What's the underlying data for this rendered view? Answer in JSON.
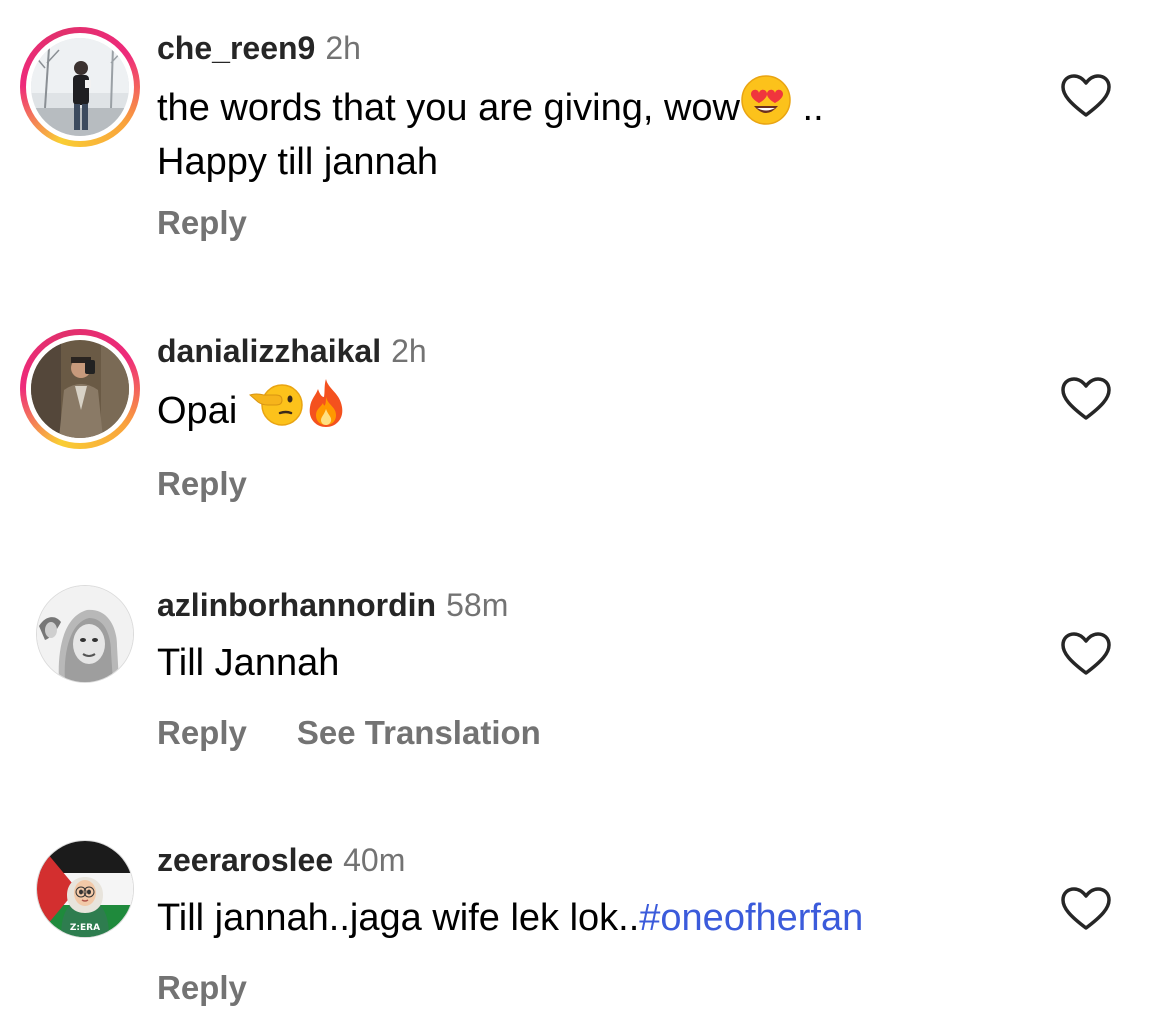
{
  "comments": [
    {
      "username": "che_reen9",
      "time": "2h",
      "text_line1": "the words that you are giving, wow",
      "text_line1_suffix": " ..",
      "text_line2": "Happy till jannah",
      "emoji": "heart-eyes-emoji",
      "reply_label": "Reply",
      "avatar_ring": true
    },
    {
      "username": "danializzhaikal",
      "time": "2h",
      "text": "Opai ",
      "emojis": [
        "pointing-face-emoji",
        "fire-emoji"
      ],
      "reply_label": "Reply",
      "avatar_ring": true
    },
    {
      "username": "azlinborhannordin",
      "time": "58m",
      "text": "Till Jannah",
      "reply_label": "Reply",
      "see_translation_label": "See Translation",
      "avatar_ring": false
    },
    {
      "username": "zeeraroslee",
      "time": "40m",
      "text": "Till jannah..jaga wife lek lok..",
      "hashtag": "#oneofherfan",
      "reply_label": "Reply",
      "avatar_ring": false,
      "avatar_badge": "Z:ERA"
    }
  ],
  "colors": {
    "username": "#262626",
    "meta": "#737373",
    "hashtag": "#3b5bdb",
    "story_ring_start": "#f9ce34",
    "story_ring_end": "#ee2a7b"
  },
  "icons": {
    "like": "heart-outline-icon"
  }
}
